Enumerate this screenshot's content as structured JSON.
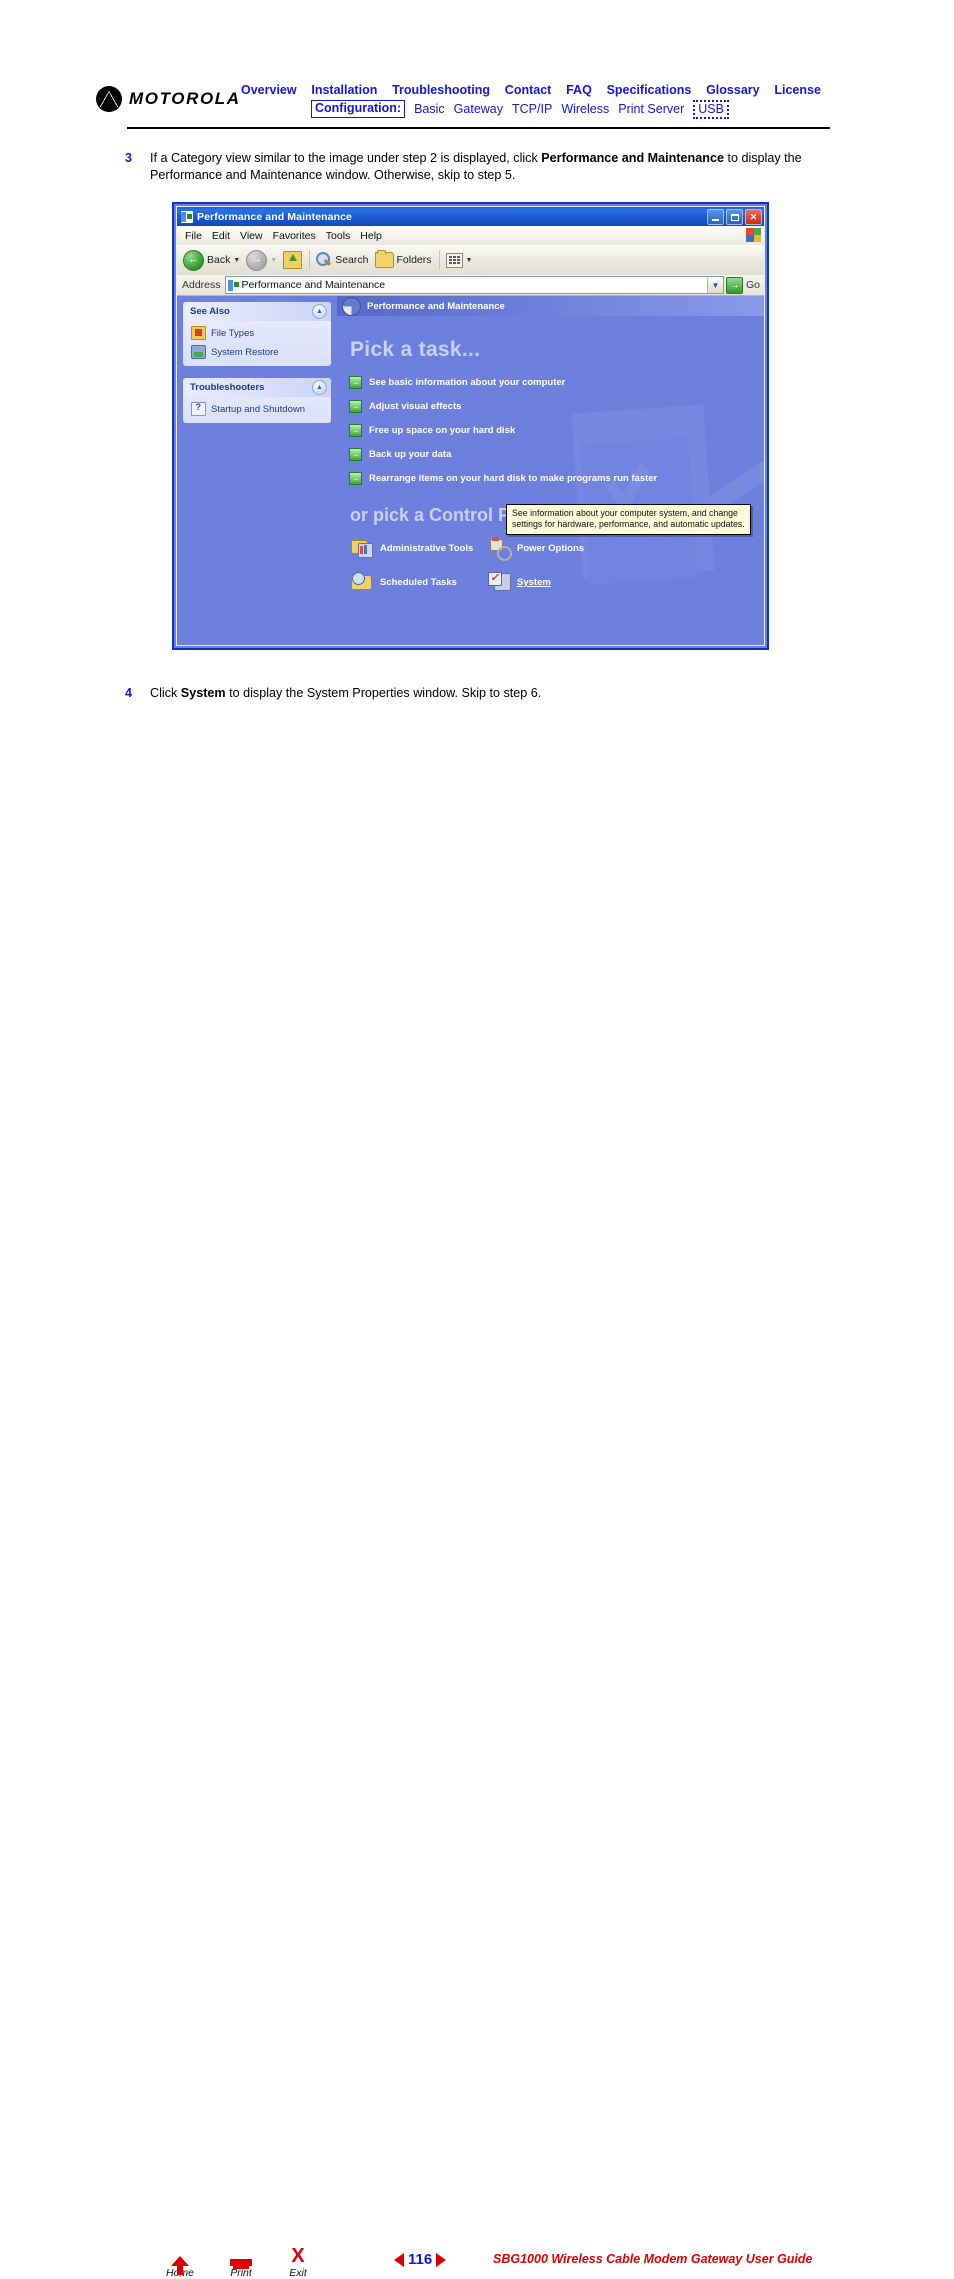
{
  "header": {
    "logo_text": "MOTOROLA",
    "nav_primary": [
      {
        "label": "Overview"
      },
      {
        "label": "Installation"
      },
      {
        "label": "Troubleshooting"
      },
      {
        "label": "Contact"
      },
      {
        "label": "FAQ"
      },
      {
        "label": "Specifications"
      },
      {
        "label": "Glossary"
      },
      {
        "label": "License"
      }
    ],
    "config_label": "Configuration:",
    "nav_config": [
      {
        "label": "Basic"
      },
      {
        "label": "Gateway"
      },
      {
        "label": "TCP/IP"
      },
      {
        "label": "Wireless"
      },
      {
        "label": "Print Server"
      }
    ],
    "usb_label": "USB",
    "accent_color": "#1515e0"
  },
  "steps": [
    {
      "number": "3",
      "part1": "If a Category view similar to the image under step 2 is displayed, click ",
      "bold": "Performance and Maintenance",
      "part2": " to display the Performance and Maintenance window. Otherwise, skip to step 5."
    },
    {
      "number": "4",
      "part1": "Click ",
      "bold": "System",
      "part2": " to display the System Properties window. Skip to step 6."
    }
  ],
  "screenshot": {
    "titlebar": {
      "title": "Performance and Maintenance",
      "minimize": "_",
      "maximize": "□",
      "close": "✕"
    },
    "menubar": [
      "File",
      "Edit",
      "View",
      "Favorites",
      "Tools",
      "Help"
    ],
    "toolbar": {
      "back_label": "Back",
      "search_label": "Search",
      "folders_label": "Folders"
    },
    "addressbar": {
      "label": "Address",
      "value": "Performance and Maintenance",
      "go_label": "Go"
    },
    "sidebar": {
      "panels": [
        {
          "title": "See Also",
          "items": [
            {
              "label": "File Types",
              "icon": "file-types-icon"
            },
            {
              "label": "System Restore",
              "icon": "system-restore-icon"
            }
          ]
        },
        {
          "title": "Troubleshooters",
          "items": [
            {
              "label": "Startup and Shutdown",
              "icon": "help-question-icon"
            }
          ]
        }
      ]
    },
    "main": {
      "banner_title": "Performance and Maintenance",
      "pick_task_heading": "Pick a task...",
      "tasks": [
        {
          "label": "See basic information about your computer"
        },
        {
          "label": "Adjust visual effects"
        },
        {
          "label": "Free up space on your hard disk"
        },
        {
          "label": "Back up your data"
        },
        {
          "label": "Rearrange items on your hard disk to make programs run faster"
        }
      ],
      "control_panel_heading": "or pick a Control Panel icon",
      "control_panel_items": [
        {
          "label": "Administrative Tools",
          "icon": "administrative-tools-icon"
        },
        {
          "label": "Power Options",
          "icon": "power-options-icon"
        },
        {
          "label": "Scheduled Tasks",
          "icon": "scheduled-tasks-icon"
        },
        {
          "label": "System",
          "icon": "system-icon"
        }
      ],
      "tooltip_line1": "See information about your computer system, and change",
      "tooltip_line2": "settings for hardware, performance, and automatic updates."
    }
  },
  "footer": {
    "home_label": "Home",
    "print_label": "Print",
    "exit_label": "Exit",
    "page_number": "116",
    "guide_title": "SBG1000 Wireless Cable Modem Gateway User Guide"
  }
}
